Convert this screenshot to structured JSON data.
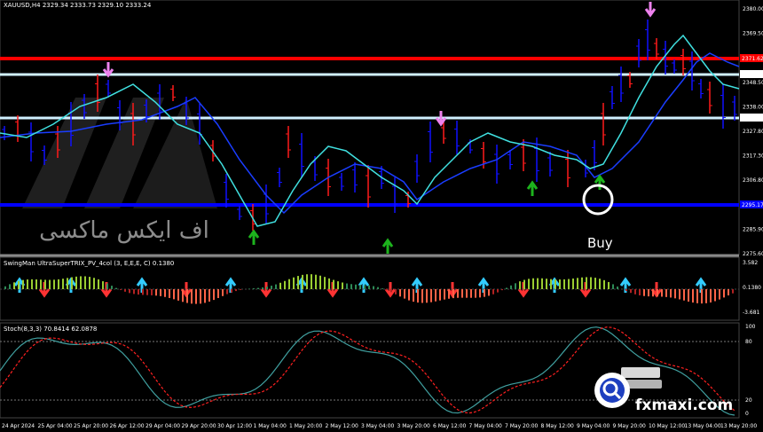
{
  "main": {
    "symbol_header": "XAUUSD,H4  2329.34 2333.73 2329.10 2333.24",
    "price_ticks": [
      "2380.00",
      "2369.50",
      "2358.75",
      "2348.50",
      "2338.00",
      "2327.80",
      "2317.30",
      "2306.80",
      "2296.55",
      "2285.90",
      "2275.60"
    ],
    "level_tags": [
      {
        "label": "2371.62",
        "color": "#ff0000"
      },
      {
        "label": "2361.50",
        "color": "#ffffff"
      },
      {
        "label": "2333.06",
        "color": "#ffffff"
      },
      {
        "label": "2295.17",
        "color": "#0000ff"
      }
    ],
    "buy_label": "Buy",
    "watermark_text": "اف ایکس ماکسی"
  },
  "trix": {
    "title": "SwingMan UltraSuperTRIX_PV_4col (3, E,E,E, C) 0.1380",
    "ticks": [
      "3.582",
      "0.1380",
      "-3.681"
    ]
  },
  "stoch": {
    "title": "Stoch(8,3,3) 70.8414 62.0878",
    "ticks": [
      "100",
      "80",
      "20",
      "0"
    ]
  },
  "time_axis": [
    "24 Apr 2024",
    "25 Apr 04:00",
    "25 Apr 20:00",
    "26 Apr 12:00",
    "29 Apr 04:00",
    "29 Apr 20:00",
    "30 Apr 12:00",
    "1 May 04:00",
    "1 May 20:00",
    "2 May 12:00",
    "3 May 04:00",
    "3 May 20:00",
    "6 May 12:00",
    "7 May 04:00",
    "7 May 20:00",
    "8 May 12:00",
    "9 May 04:00",
    "9 May 20:00",
    "10 May 12:00",
    "13 May 04:00",
    "13 May 20:00"
  ],
  "brand": {
    "site": "fxmaxi.com"
  },
  "colors": {
    "bull": "#1010ff",
    "bear": "#ff1a1a",
    "resistance": "#ff0000",
    "support": "#0000ff",
    "ma_fast": "#40e0e0",
    "ma_slow": "#1a3dff"
  }
}
